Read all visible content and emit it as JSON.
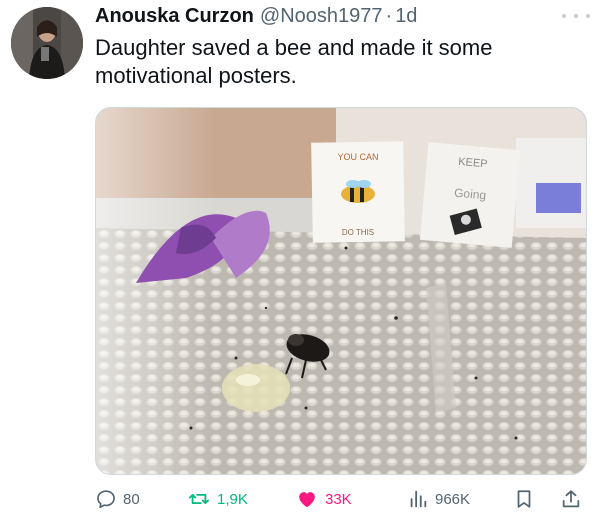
{
  "author": {
    "display_name": "Anouska Curzon",
    "handle": "@Noosh1977",
    "separator": "·",
    "time": "1d"
  },
  "tweet": {
    "text": "Daughter saved a bee and made it some motivational posters."
  },
  "media": {
    "poster_left_top": "YOU CAN",
    "poster_left_bottom": "DO THIS",
    "poster_right_top": "KEEP",
    "poster_right_bottom": "Going"
  },
  "actions": {
    "replies": "80",
    "retweets": "1,9K",
    "likes": "33K",
    "views": "966K"
  },
  "colors": {
    "retweet": "#00ba7c",
    "like": "#f91880",
    "muted": "#536471"
  }
}
